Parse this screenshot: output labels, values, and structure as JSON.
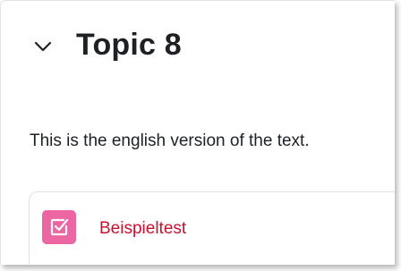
{
  "section": {
    "title": "Topic 8",
    "collapse_icon": "chevron-down-icon",
    "summary": "This is the english version of the text."
  },
  "activity": {
    "name": "Beispieltest",
    "icon": "quiz-checkbox-icon",
    "icon_color": "#eb66a2",
    "link_color": "#c8102e"
  }
}
